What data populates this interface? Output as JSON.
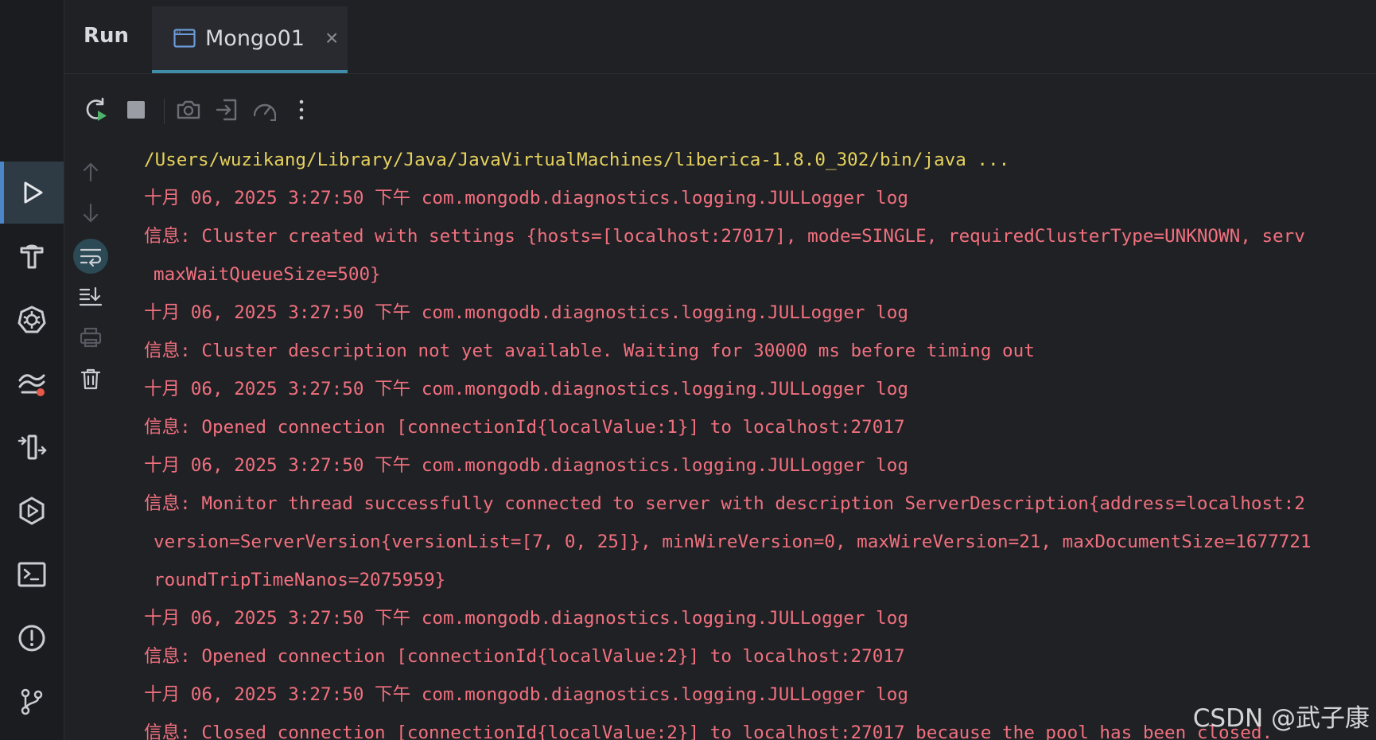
{
  "tabs": {
    "run_label": "Run",
    "active_tab": "Mongo01",
    "close_glyph": "×"
  },
  "rail_icons": [
    "run-icon",
    "build-icon",
    "kubernetes-icon",
    "services-icon",
    "deploy-icon",
    "run-configurations-icon",
    "terminal-icon",
    "problems-icon",
    "git-icon"
  ],
  "toolbar_icons": [
    "rerun-icon",
    "stop-icon",
    "screenshot-icon",
    "exit-icon",
    "profiler-icon",
    "more-vertical-icon"
  ],
  "side_tool_icons": [
    "up-arrow-icon",
    "down-arrow-icon",
    "soft-wrap-icon",
    "scroll-to-end-icon",
    "print-icon",
    "trash-icon"
  ],
  "console": {
    "lines": [
      {
        "text": "/Users/wuzikang/Library/Java/JavaVirtualMachines/liberica-1.8.0_302/bin/java ...",
        "color": "yellow"
      },
      {
        "text": "十月 06, 2025 3:27:50 下午 com.mongodb.diagnostics.logging.JULLogger log",
        "color": "red"
      },
      {
        "text": "信息: Cluster created with settings {hosts=[localhost:27017], mode=SINGLE, requiredClusterType=UNKNOWN, serv",
        "color": "red"
      },
      {
        "text": "maxWaitQueueSize=500}",
        "color": "red",
        "continuation": true
      },
      {
        "text": "十月 06, 2025 3:27:50 下午 com.mongodb.diagnostics.logging.JULLogger log",
        "color": "red"
      },
      {
        "text": "信息: Cluster description not yet available. Waiting for 30000 ms before timing out",
        "color": "red"
      },
      {
        "text": "十月 06, 2025 3:27:50 下午 com.mongodb.diagnostics.logging.JULLogger log",
        "color": "red"
      },
      {
        "text": "信息: Opened connection [connectionId{localValue:1}] to localhost:27017",
        "color": "red"
      },
      {
        "text": "十月 06, 2025 3:27:50 下午 com.mongodb.diagnostics.logging.JULLogger log",
        "color": "red"
      },
      {
        "text": "信息: Monitor thread successfully connected to server with description ServerDescription{address=localhost:2",
        "color": "red"
      },
      {
        "text": "version=ServerVersion{versionList=[7, 0, 25]}, minWireVersion=0, maxWireVersion=21, maxDocumentSize=1677721",
        "color": "red",
        "continuation": true
      },
      {
        "text": "roundTripTimeNanos=2075959}",
        "color": "red",
        "continuation": true
      },
      {
        "text": "十月 06, 2025 3:27:50 下午 com.mongodb.diagnostics.logging.JULLogger log",
        "color": "red"
      },
      {
        "text": "信息: Opened connection [connectionId{localValue:2}] to localhost:27017",
        "color": "red"
      },
      {
        "text": "十月 06, 2025 3:27:50 下午 com.mongodb.diagnostics.logging.JULLogger log",
        "color": "red"
      },
      {
        "text": "信息: Closed connection [connectionId{localValue:2}] to localhost:27017 because the pool has been closed.",
        "color": "red"
      }
    ]
  },
  "watermark": "CSDN @武子康",
  "colors": {
    "accent": "#3f8ea9",
    "console_red": "#f2707e",
    "console_yellow": "#e6d15c"
  }
}
